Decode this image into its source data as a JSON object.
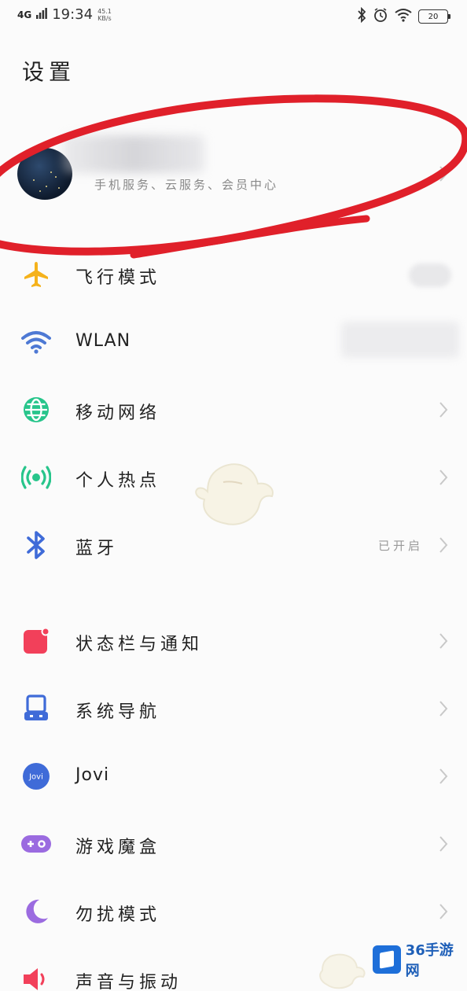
{
  "status_bar": {
    "network": "4G",
    "time": "19:34",
    "speed": "45.1",
    "speed_unit": "KB/s",
    "icons": [
      "bluetooth-icon",
      "alarm-icon",
      "wifi-icon",
      "battery-icon"
    ],
    "battery": "20"
  },
  "page": {
    "title": "设置"
  },
  "account": {
    "subtitle": "手机服务、云服务、会员中心"
  },
  "settings": {
    "airplane": {
      "label": "飞行模式",
      "icon": "airplane-icon",
      "color": "#f5b21b"
    },
    "wlan": {
      "label": "WLAN",
      "icon": "wifi-icon",
      "color": "#4e79d4"
    },
    "mobile_network": {
      "label": "移动网络",
      "icon": "globe-icon",
      "color": "#27c58b"
    },
    "hotspot": {
      "label": "个人热点",
      "icon": "hotspot-icon",
      "color": "#27c58b"
    },
    "bluetooth": {
      "label": "蓝牙",
      "value": "已开启",
      "icon": "bluetooth-icon",
      "color": "#3f6bd8"
    },
    "status_bar_notifications": {
      "label": "状态栏与通知",
      "icon": "notification-icon",
      "color": "#f2405a"
    },
    "system_navigation": {
      "label": "系统导航",
      "icon": "navigation-icon",
      "color": "#3f6bd8"
    },
    "jovi": {
      "label": "Jovi",
      "icon_text": "Jovi",
      "icon": "jovi-icon",
      "color": "#3f6bd8"
    },
    "game_box": {
      "label": "游戏魔盒",
      "icon": "gamepad-icon",
      "color": "#9b6be0"
    },
    "do_not_disturb": {
      "label": "勿扰模式",
      "icon": "moon-icon",
      "color": "#9b6be0"
    },
    "sound_vibration": {
      "label": "声音与振动",
      "icon": "speaker-icon",
      "color": "#f2405a"
    }
  },
  "watermark": {
    "text": "36手游网"
  },
  "colors": {
    "annotation_circle": "#e0202a",
    "chevron": "#c8c8c8"
  }
}
